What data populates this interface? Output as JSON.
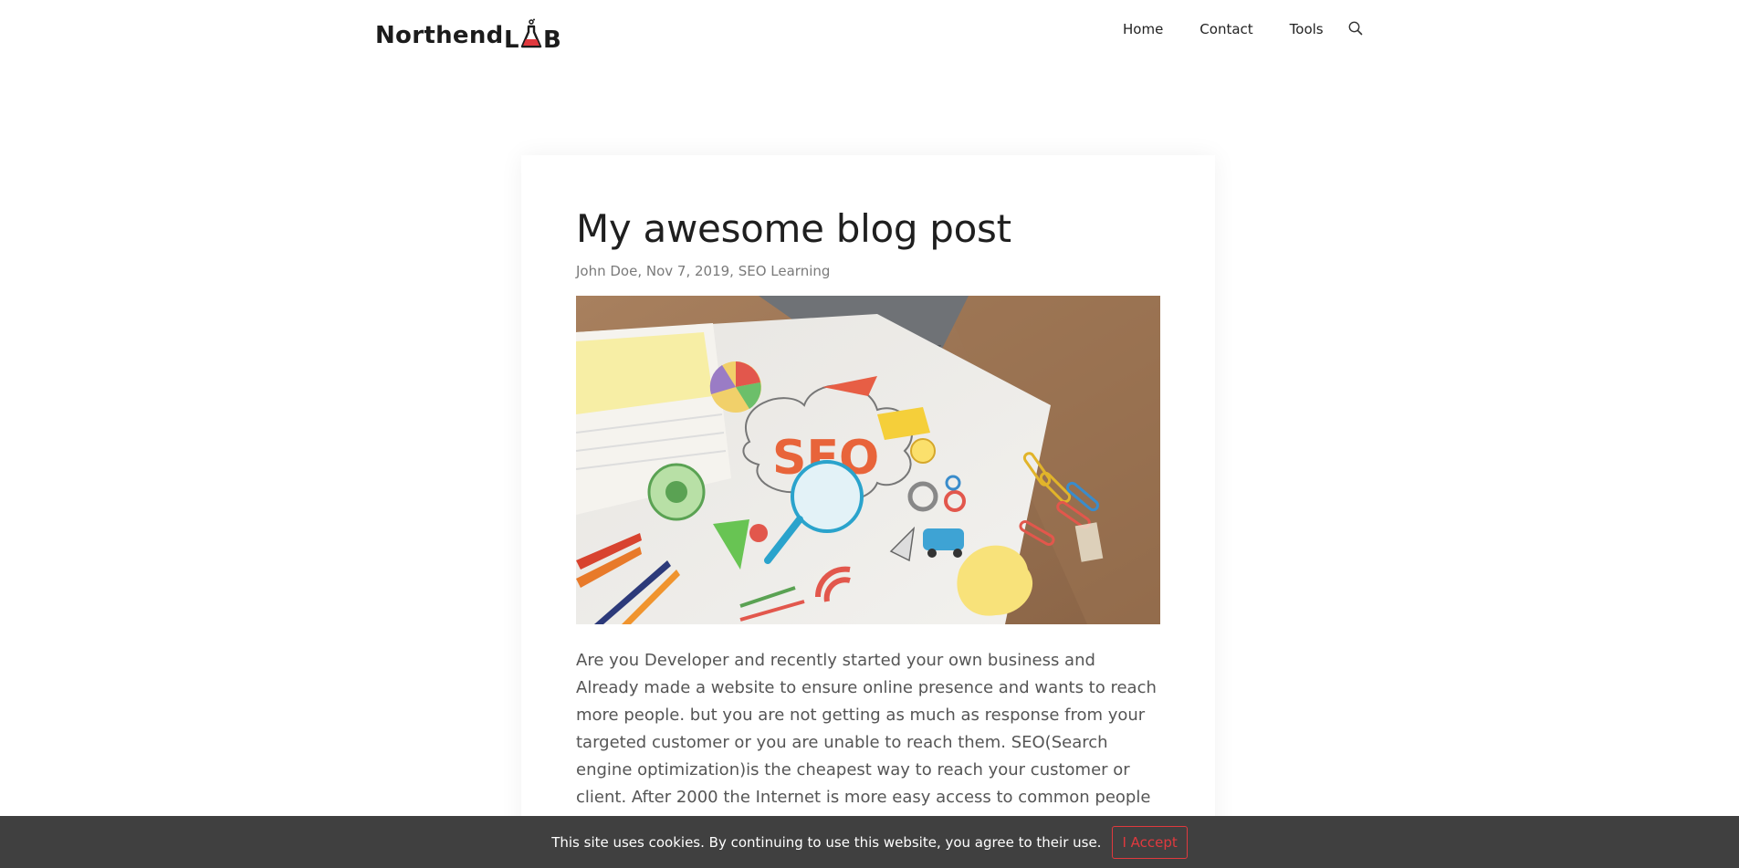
{
  "brand": {
    "name_prefix": "Northend",
    "name_suffix": "LAB",
    "accent": "#e0393e"
  },
  "nav": {
    "items": [
      "Home",
      "Contact",
      "Tools"
    ],
    "search_icon": "search-icon"
  },
  "post": {
    "title": "My awesome blog post",
    "meta": "John Doe, Nov 7, 2019, SEO Learning",
    "image_label": "SEO",
    "body": "Are you Developer and recently started your own business and Already made a website to ensure online presence and wants to reach more people. but you are not getting as much as response from your targeted customer or you are unable to reach them. SEO(Search engine optimization)is the cheapest way to reach your customer or client. After 2000 the Internet is more easy access to common people and most of the netizens to find out"
  },
  "cookie": {
    "text": "This site uses cookies. By continuing to use this website, you agree to their use.",
    "accept_label": "I Accept",
    "bar_color": "#404040"
  }
}
